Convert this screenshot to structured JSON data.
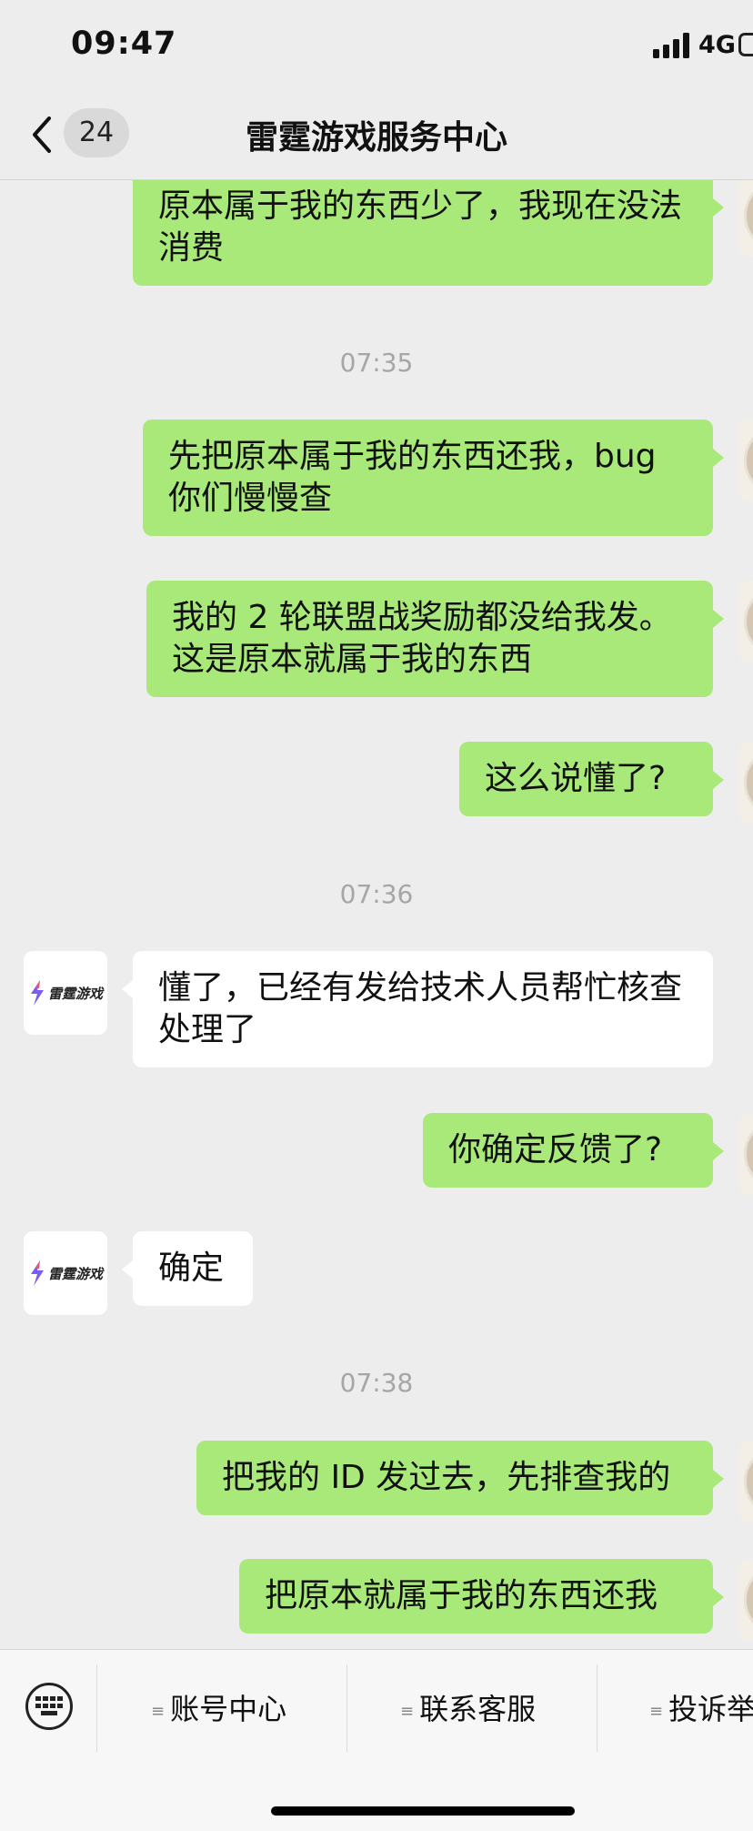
{
  "status_bar": {
    "time": "09:47",
    "network": "4G"
  },
  "nav": {
    "back_icon": "chevron-left-icon",
    "unread_count": "24",
    "title": "雷霆游戏服务中心"
  },
  "chat": {
    "messages": [
      {
        "from": "me",
        "text": "原本属于我的东西少了，我现在没法消费"
      },
      {
        "timestamp": "07:35"
      },
      {
        "from": "me",
        "text": "先把原本属于我的东西还我，bug 你们慢慢查"
      },
      {
        "from": "me",
        "text": "我的 2 轮联盟战奖励都没给我发。这是原本就属于我的东西"
      },
      {
        "from": "me",
        "text": "这么说懂了?"
      },
      {
        "timestamp": "07:36"
      },
      {
        "from": "service",
        "text": "懂了，已经有发给技术人员帮忙核查处理了"
      },
      {
        "from": "me",
        "text": "你确定反馈了?"
      },
      {
        "from": "service",
        "text": "确定"
      },
      {
        "timestamp": "07:38"
      },
      {
        "from": "me",
        "text": "把我的 ID 发过去，先排查我的"
      },
      {
        "from": "me",
        "text": "把原本就属于我的东西还我"
      }
    ],
    "service_avatar_text": "雷霆游戏"
  },
  "bottom_menu": {
    "keyboard_icon": "keyboard-icon",
    "items": [
      "账号中心",
      "联系客服",
      "投诉举"
    ]
  },
  "colors": {
    "outgoing_bubble": "#a9e97a",
    "incoming_bubble": "#ffffff",
    "background": "#ededed",
    "timestamp": "#a6a6a6"
  }
}
